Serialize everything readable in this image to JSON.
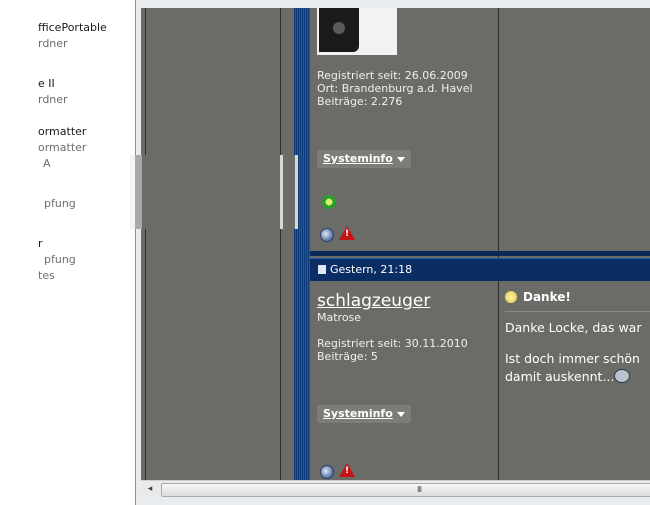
{
  "sidebar": {
    "items": [
      {
        "text": "fficePortable",
        "style": "dark"
      },
      {
        "text": "rdner",
        "style": "gray"
      },
      {
        "text": "e II",
        "style": "dark"
      },
      {
        "text": "rdner",
        "style": "gray"
      },
      {
        "text": "ormatter",
        "style": "dark"
      },
      {
        "text": "ormatter",
        "style": "gray"
      },
      {
        "text": "A",
        "style": "gray"
      },
      {
        "text": "pfung",
        "style": "gray"
      },
      {
        "text": "r",
        "style": "dark"
      },
      {
        "text": "pfung",
        "style": "gray"
      },
      {
        "text": "tes",
        "style": "gray"
      }
    ]
  },
  "post1": {
    "registered": "Registriert seit: 26.06.2009",
    "location": "Ort: Brandenburg a.d. Havel",
    "posts": "Beiträge: 2.276",
    "systeminfo_label": "Systeminfo"
  },
  "post2": {
    "date": "Gestern, 21:18",
    "username": "schlagzeuger",
    "rank": "Matrose",
    "registered": "Registriert seit: 30.11.2010",
    "posts": "Beiträge: 5",
    "systeminfo_label": "Systeminfo",
    "title": "Danke!",
    "message_line1": "Danke Locke, das war",
    "message_line2": "Ist doch immer schön",
    "message_line3": "damit auskennt..."
  },
  "scrollbar": {
    "left_arrow": "◂",
    "grip": "III"
  },
  "colors": {
    "forum_bg": "#6b6b68",
    "header_blue": "#0a2e63",
    "stripe_blue": "#1d5aa8"
  }
}
